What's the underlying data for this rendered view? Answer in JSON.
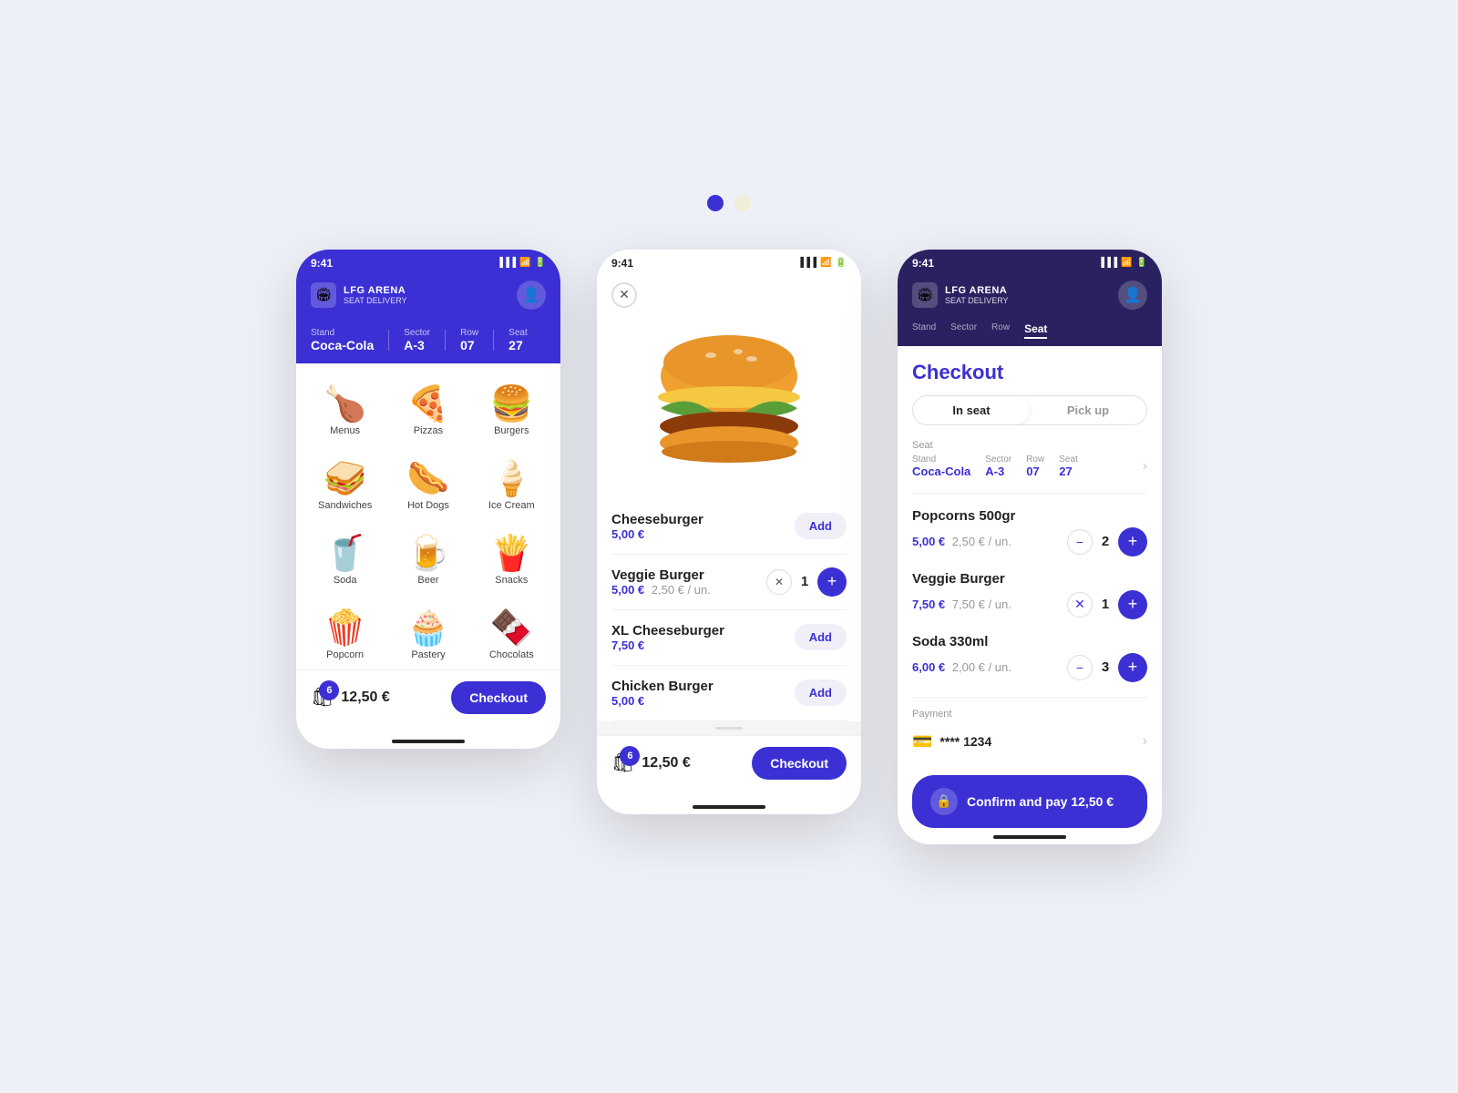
{
  "app": {
    "name": "LFG ARENA",
    "subtitle": "SEAT DELIVERY",
    "time": "9:41"
  },
  "pagination": {
    "dot1": "active",
    "dot2": "inactive"
  },
  "screen1": {
    "stand_label": "Stand",
    "stand_value": "Coca-Cola",
    "sector_label": "Sector",
    "sector_value": "A-3",
    "row_label": "Row",
    "row_value": "07",
    "seat_label": "Seat",
    "seat_value": "27",
    "categories": [
      {
        "label": "Menus",
        "emoji": "🍗"
      },
      {
        "label": "Pizzas",
        "emoji": "🍕"
      },
      {
        "label": "Burgers",
        "emoji": "🍔"
      },
      {
        "label": "Sandwiches",
        "emoji": "🥪"
      },
      {
        "label": "Hot Dogs",
        "emoji": "🌭"
      },
      {
        "label": "Ice Cream",
        "emoji": "🍦"
      },
      {
        "label": "Soda",
        "emoji": "🥤"
      },
      {
        "label": "Beer",
        "emoji": "🍺"
      },
      {
        "label": "Snacks",
        "emoji": "🍟"
      },
      {
        "label": "Popcorn",
        "emoji": "🍿"
      },
      {
        "label": "Pastery",
        "emoji": "🧁"
      },
      {
        "label": "Chocolats",
        "emoji": "🍫"
      }
    ],
    "cart_count": "6",
    "cart_total": "12,50 €",
    "checkout_label": "Checkout"
  },
  "screen2": {
    "hero_emoji": "🍔",
    "products": [
      {
        "name": "Cheeseburger",
        "price": "5,00 €",
        "per_unit": null,
        "qty": null,
        "action": "Add"
      },
      {
        "name": "Veggie Burger",
        "price": "5,00 €",
        "per_unit": "2,50 € / un.",
        "qty": "1",
        "action": "qty"
      },
      {
        "name": "XL Cheeseburger",
        "price": "7,50 €",
        "per_unit": null,
        "qty": null,
        "action": "Add"
      },
      {
        "name": "Chicken Burger",
        "price": "5,00 €",
        "per_unit": null,
        "qty": null,
        "action": "Add"
      }
    ],
    "cart_count": "6",
    "cart_total": "12,50 €",
    "checkout_label": "Checkout"
  },
  "screen3": {
    "stand_label": "Stand",
    "sector_label": "Sector",
    "row_label": "Row",
    "seat_label": "Seat",
    "checkout_title": "Checkout",
    "tab_inseat": "In seat",
    "tab_pickup": "Pick up",
    "seat_section_label": "Seat",
    "seat_stand": "Coca-Cola",
    "seat_stand_label": "Stand",
    "seat_sector": "A-3",
    "seat_sector_label": "Sector",
    "seat_row": "07",
    "seat_row_label": "Row",
    "seat_seat": "27",
    "seat_seat_label": "Seat",
    "items": [
      {
        "name": "Popcorns 500gr",
        "price": "5,00 €",
        "per_unit": "2,50 € / un.",
        "qty": "2",
        "control": "minus"
      },
      {
        "name": "Veggie Burger",
        "price": "7,50 €",
        "per_unit": "7,50 € / un.",
        "qty": "1",
        "control": "x"
      },
      {
        "name": "Soda 330ml",
        "price": "6,00 €",
        "per_unit": "2,00 € / un.",
        "qty": "3",
        "control": "minus"
      }
    ],
    "payment_label": "Payment",
    "card_number": "**** 1234",
    "confirm_label": "Confirm and pay",
    "confirm_amount": "12,50 €"
  }
}
